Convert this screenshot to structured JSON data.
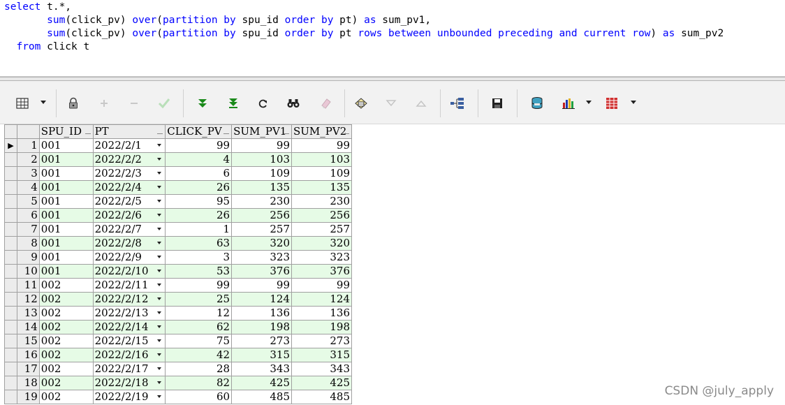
{
  "sql": {
    "lines": [
      [
        {
          "t": "kw",
          "v": "select"
        },
        {
          "t": "id",
          "v": " t.*,"
        }
      ],
      [
        {
          "t": "id",
          "v": "       "
        },
        {
          "t": "fn",
          "v": "sum"
        },
        {
          "t": "id",
          "v": "(click_pv) "
        },
        {
          "t": "kw",
          "v": "over"
        },
        {
          "t": "id",
          "v": "("
        },
        {
          "t": "kw",
          "v": "partition by"
        },
        {
          "t": "id",
          "v": " spu_id "
        },
        {
          "t": "kw",
          "v": "order by"
        },
        {
          "t": "id",
          "v": " pt) "
        },
        {
          "t": "kw",
          "v": "as"
        },
        {
          "t": "id",
          "v": " sum_pv1,"
        }
      ],
      [
        {
          "t": "id",
          "v": "       "
        },
        {
          "t": "fn",
          "v": "sum"
        },
        {
          "t": "id",
          "v": "(click_pv) "
        },
        {
          "t": "kw",
          "v": "over"
        },
        {
          "t": "id",
          "v": "("
        },
        {
          "t": "kw",
          "v": "partition by"
        },
        {
          "t": "id",
          "v": " spu_id "
        },
        {
          "t": "kw",
          "v": "order by"
        },
        {
          "t": "id",
          "v": " pt "
        },
        {
          "t": "kw",
          "v": "rows between unbounded preceding and current row"
        },
        {
          "t": "id",
          "v": ") "
        },
        {
          "t": "kw",
          "v": "as"
        },
        {
          "t": "id",
          "v": " sum_pv2"
        }
      ],
      [
        {
          "t": "id",
          "v": "  "
        },
        {
          "t": "kw",
          "v": "from"
        },
        {
          "t": "id",
          "v": " click t"
        }
      ]
    ]
  },
  "toolbar": {
    "buttons": [
      {
        "name": "grid-view-icon"
      },
      {
        "name": "lock-icon"
      },
      {
        "name": "add-record-icon"
      },
      {
        "name": "delete-record-icon"
      },
      {
        "name": "post-changes-icon"
      },
      {
        "name": "fetch-next-page-icon"
      },
      {
        "name": "fetch-last-page-icon"
      },
      {
        "name": "refresh-icon"
      },
      {
        "name": "find-icon"
      },
      {
        "name": "clear-icon"
      },
      {
        "name": "query-by-example-icon"
      },
      {
        "name": "sort-descending-icon"
      },
      {
        "name": "sort-ascending-icon"
      },
      {
        "name": "export-tree-icon"
      },
      {
        "name": "save-icon"
      },
      {
        "name": "database-icon"
      },
      {
        "name": "chart-icon"
      },
      {
        "name": "export-table-icon"
      }
    ]
  },
  "grid": {
    "columns": [
      "SPU_ID",
      "PT",
      "CLICK_PV",
      "SUM_PV1",
      "SUM_PV2"
    ],
    "current_row_marker": "▶",
    "rows": [
      {
        "num": "1",
        "spu_id": "001",
        "pt": "2022/2/1",
        "click_pv": "99",
        "sum_pv1": "99",
        "sum_pv2": "99"
      },
      {
        "num": "2",
        "spu_id": "001",
        "pt": "2022/2/2",
        "click_pv": "4",
        "sum_pv1": "103",
        "sum_pv2": "103"
      },
      {
        "num": "3",
        "spu_id": "001",
        "pt": "2022/2/3",
        "click_pv": "6",
        "sum_pv1": "109",
        "sum_pv2": "109"
      },
      {
        "num": "4",
        "spu_id": "001",
        "pt": "2022/2/4",
        "click_pv": "26",
        "sum_pv1": "135",
        "sum_pv2": "135"
      },
      {
        "num": "5",
        "spu_id": "001",
        "pt": "2022/2/5",
        "click_pv": "95",
        "sum_pv1": "230",
        "sum_pv2": "230"
      },
      {
        "num": "6",
        "spu_id": "001",
        "pt": "2022/2/6",
        "click_pv": "26",
        "sum_pv1": "256",
        "sum_pv2": "256"
      },
      {
        "num": "7",
        "spu_id": "001",
        "pt": "2022/2/7",
        "click_pv": "1",
        "sum_pv1": "257",
        "sum_pv2": "257"
      },
      {
        "num": "8",
        "spu_id": "001",
        "pt": "2022/2/8",
        "click_pv": "63",
        "sum_pv1": "320",
        "sum_pv2": "320"
      },
      {
        "num": "9",
        "spu_id": "001",
        "pt": "2022/2/9",
        "click_pv": "3",
        "sum_pv1": "323",
        "sum_pv2": "323"
      },
      {
        "num": "10",
        "spu_id": "001",
        "pt": "2022/2/10",
        "click_pv": "53",
        "sum_pv1": "376",
        "sum_pv2": "376"
      },
      {
        "num": "11",
        "spu_id": "002",
        "pt": "2022/2/11",
        "click_pv": "99",
        "sum_pv1": "99",
        "sum_pv2": "99"
      },
      {
        "num": "12",
        "spu_id": "002",
        "pt": "2022/2/12",
        "click_pv": "25",
        "sum_pv1": "124",
        "sum_pv2": "124"
      },
      {
        "num": "13",
        "spu_id": "002",
        "pt": "2022/2/13",
        "click_pv": "12",
        "sum_pv1": "136",
        "sum_pv2": "136"
      },
      {
        "num": "14",
        "spu_id": "002",
        "pt": "2022/2/14",
        "click_pv": "62",
        "sum_pv1": "198",
        "sum_pv2": "198"
      },
      {
        "num": "15",
        "spu_id": "002",
        "pt": "2022/2/15",
        "click_pv": "75",
        "sum_pv1": "273",
        "sum_pv2": "273"
      },
      {
        "num": "16",
        "spu_id": "002",
        "pt": "2022/2/16",
        "click_pv": "42",
        "sum_pv1": "315",
        "sum_pv2": "315"
      },
      {
        "num": "17",
        "spu_id": "002",
        "pt": "2022/2/17",
        "click_pv": "28",
        "sum_pv1": "343",
        "sum_pv2": "343"
      },
      {
        "num": "18",
        "spu_id": "002",
        "pt": "2022/2/18",
        "click_pv": "82",
        "sum_pv1": "425",
        "sum_pv2": "425"
      },
      {
        "num": "19",
        "spu_id": "002",
        "pt": "2022/2/19",
        "click_pv": "60",
        "sum_pv1": "485",
        "sum_pv2": "485"
      }
    ]
  },
  "watermark": "CSDN @july_apply",
  "colors": {
    "keyword": "#0000ff",
    "alt_row": "#e6fbe6",
    "header_bg": "#ececec"
  }
}
